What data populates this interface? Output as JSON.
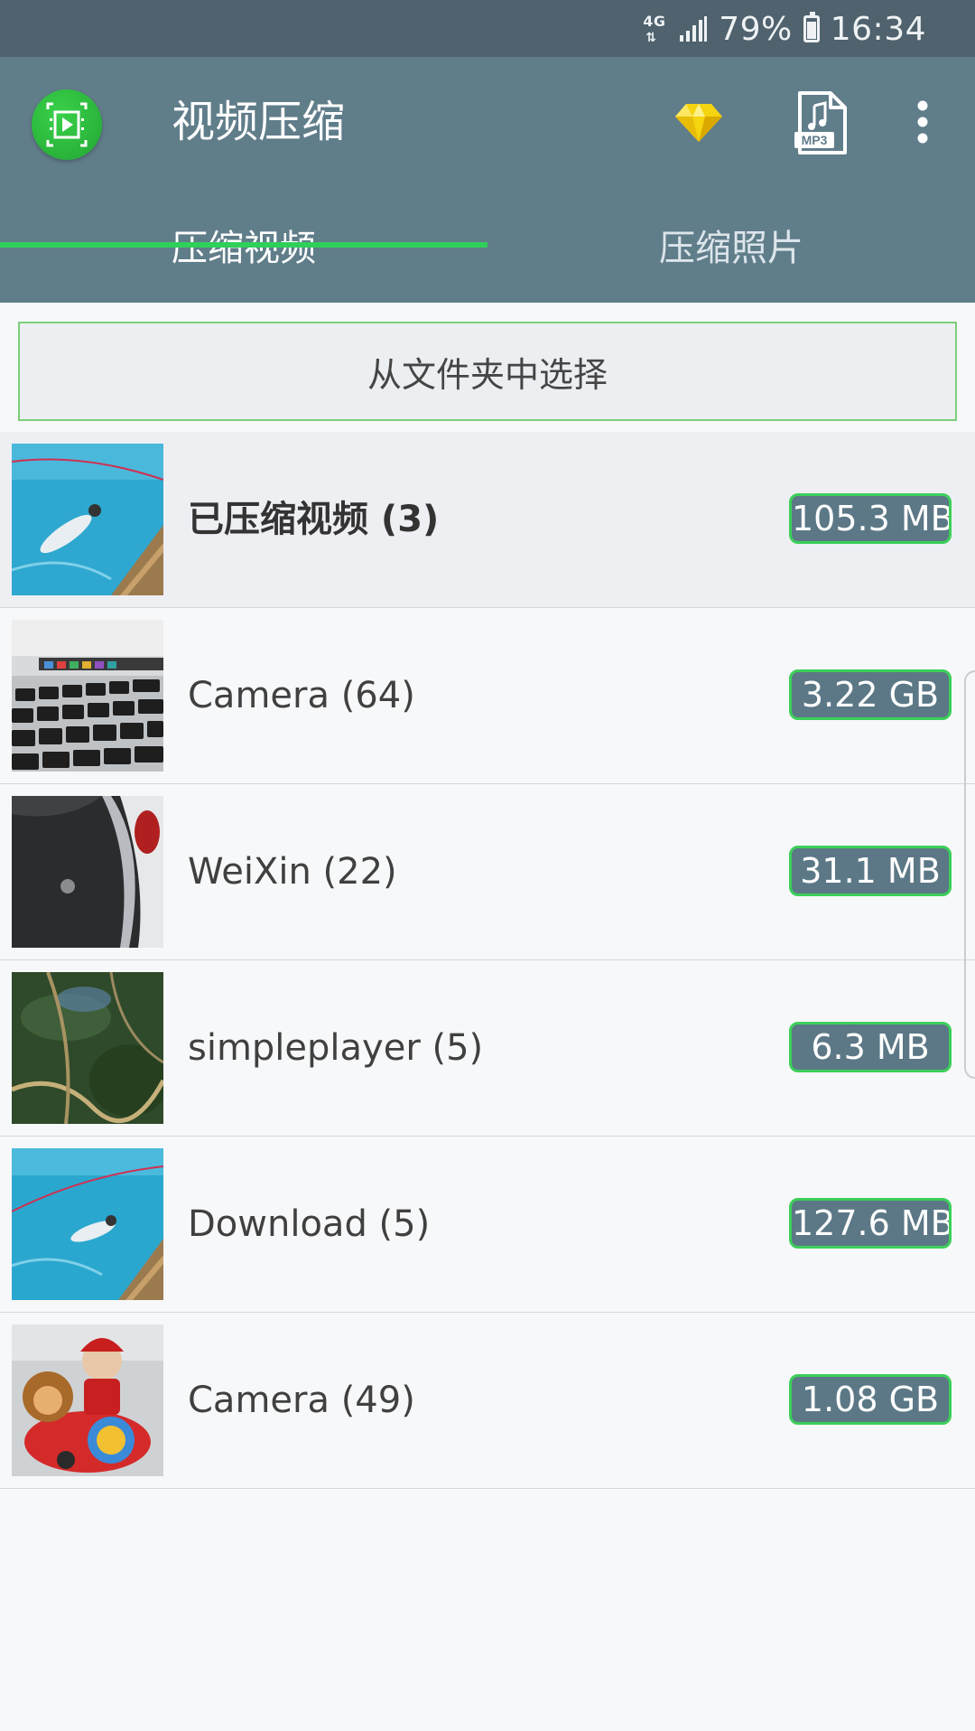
{
  "status_bar": {
    "network": "4G",
    "battery": "79%",
    "battery_level": 0.79,
    "time": "16:34"
  },
  "app_bar": {
    "title": "视频压缩",
    "icons": {
      "logo": "video-compress-app-logo",
      "premium": "diamond-icon",
      "mp3": "mp3-file-icon",
      "more": "more-vertical-icon"
    },
    "mp3_label": "MP3",
    "colors": {
      "status_bar": "#4f626d",
      "app_bar": "#607d8a",
      "accent": "#2fd05a",
      "logo": "#2bb83b",
      "badge": "#5c7886",
      "diamond": "#f5d410"
    }
  },
  "tabs": [
    {
      "label": "压缩视频",
      "active": true
    },
    {
      "label": "压缩照片",
      "active": false
    }
  ],
  "select_folder": {
    "label": "从文件夹中选择"
  },
  "folders": [
    {
      "name": "已压缩视频 (3)",
      "size": "105.3 MB",
      "thumb": "pool-swimmer"
    },
    {
      "name": "Camera (64)",
      "size": "3.22 GB",
      "thumb": "laptop-keyboard"
    },
    {
      "name": "WeiXin (22)",
      "size": "31.1 MB",
      "thumb": "car-rear"
    },
    {
      "name": "simpleplayer (5)",
      "size": "6.3 MB",
      "thumb": "aerial-forest"
    },
    {
      "name": "Download (5)",
      "size": "127.6 MB",
      "thumb": "pool-swimmer"
    },
    {
      "name": "Camera (49)",
      "size": "1.08 GB",
      "thumb": "kiddie-ride"
    }
  ]
}
